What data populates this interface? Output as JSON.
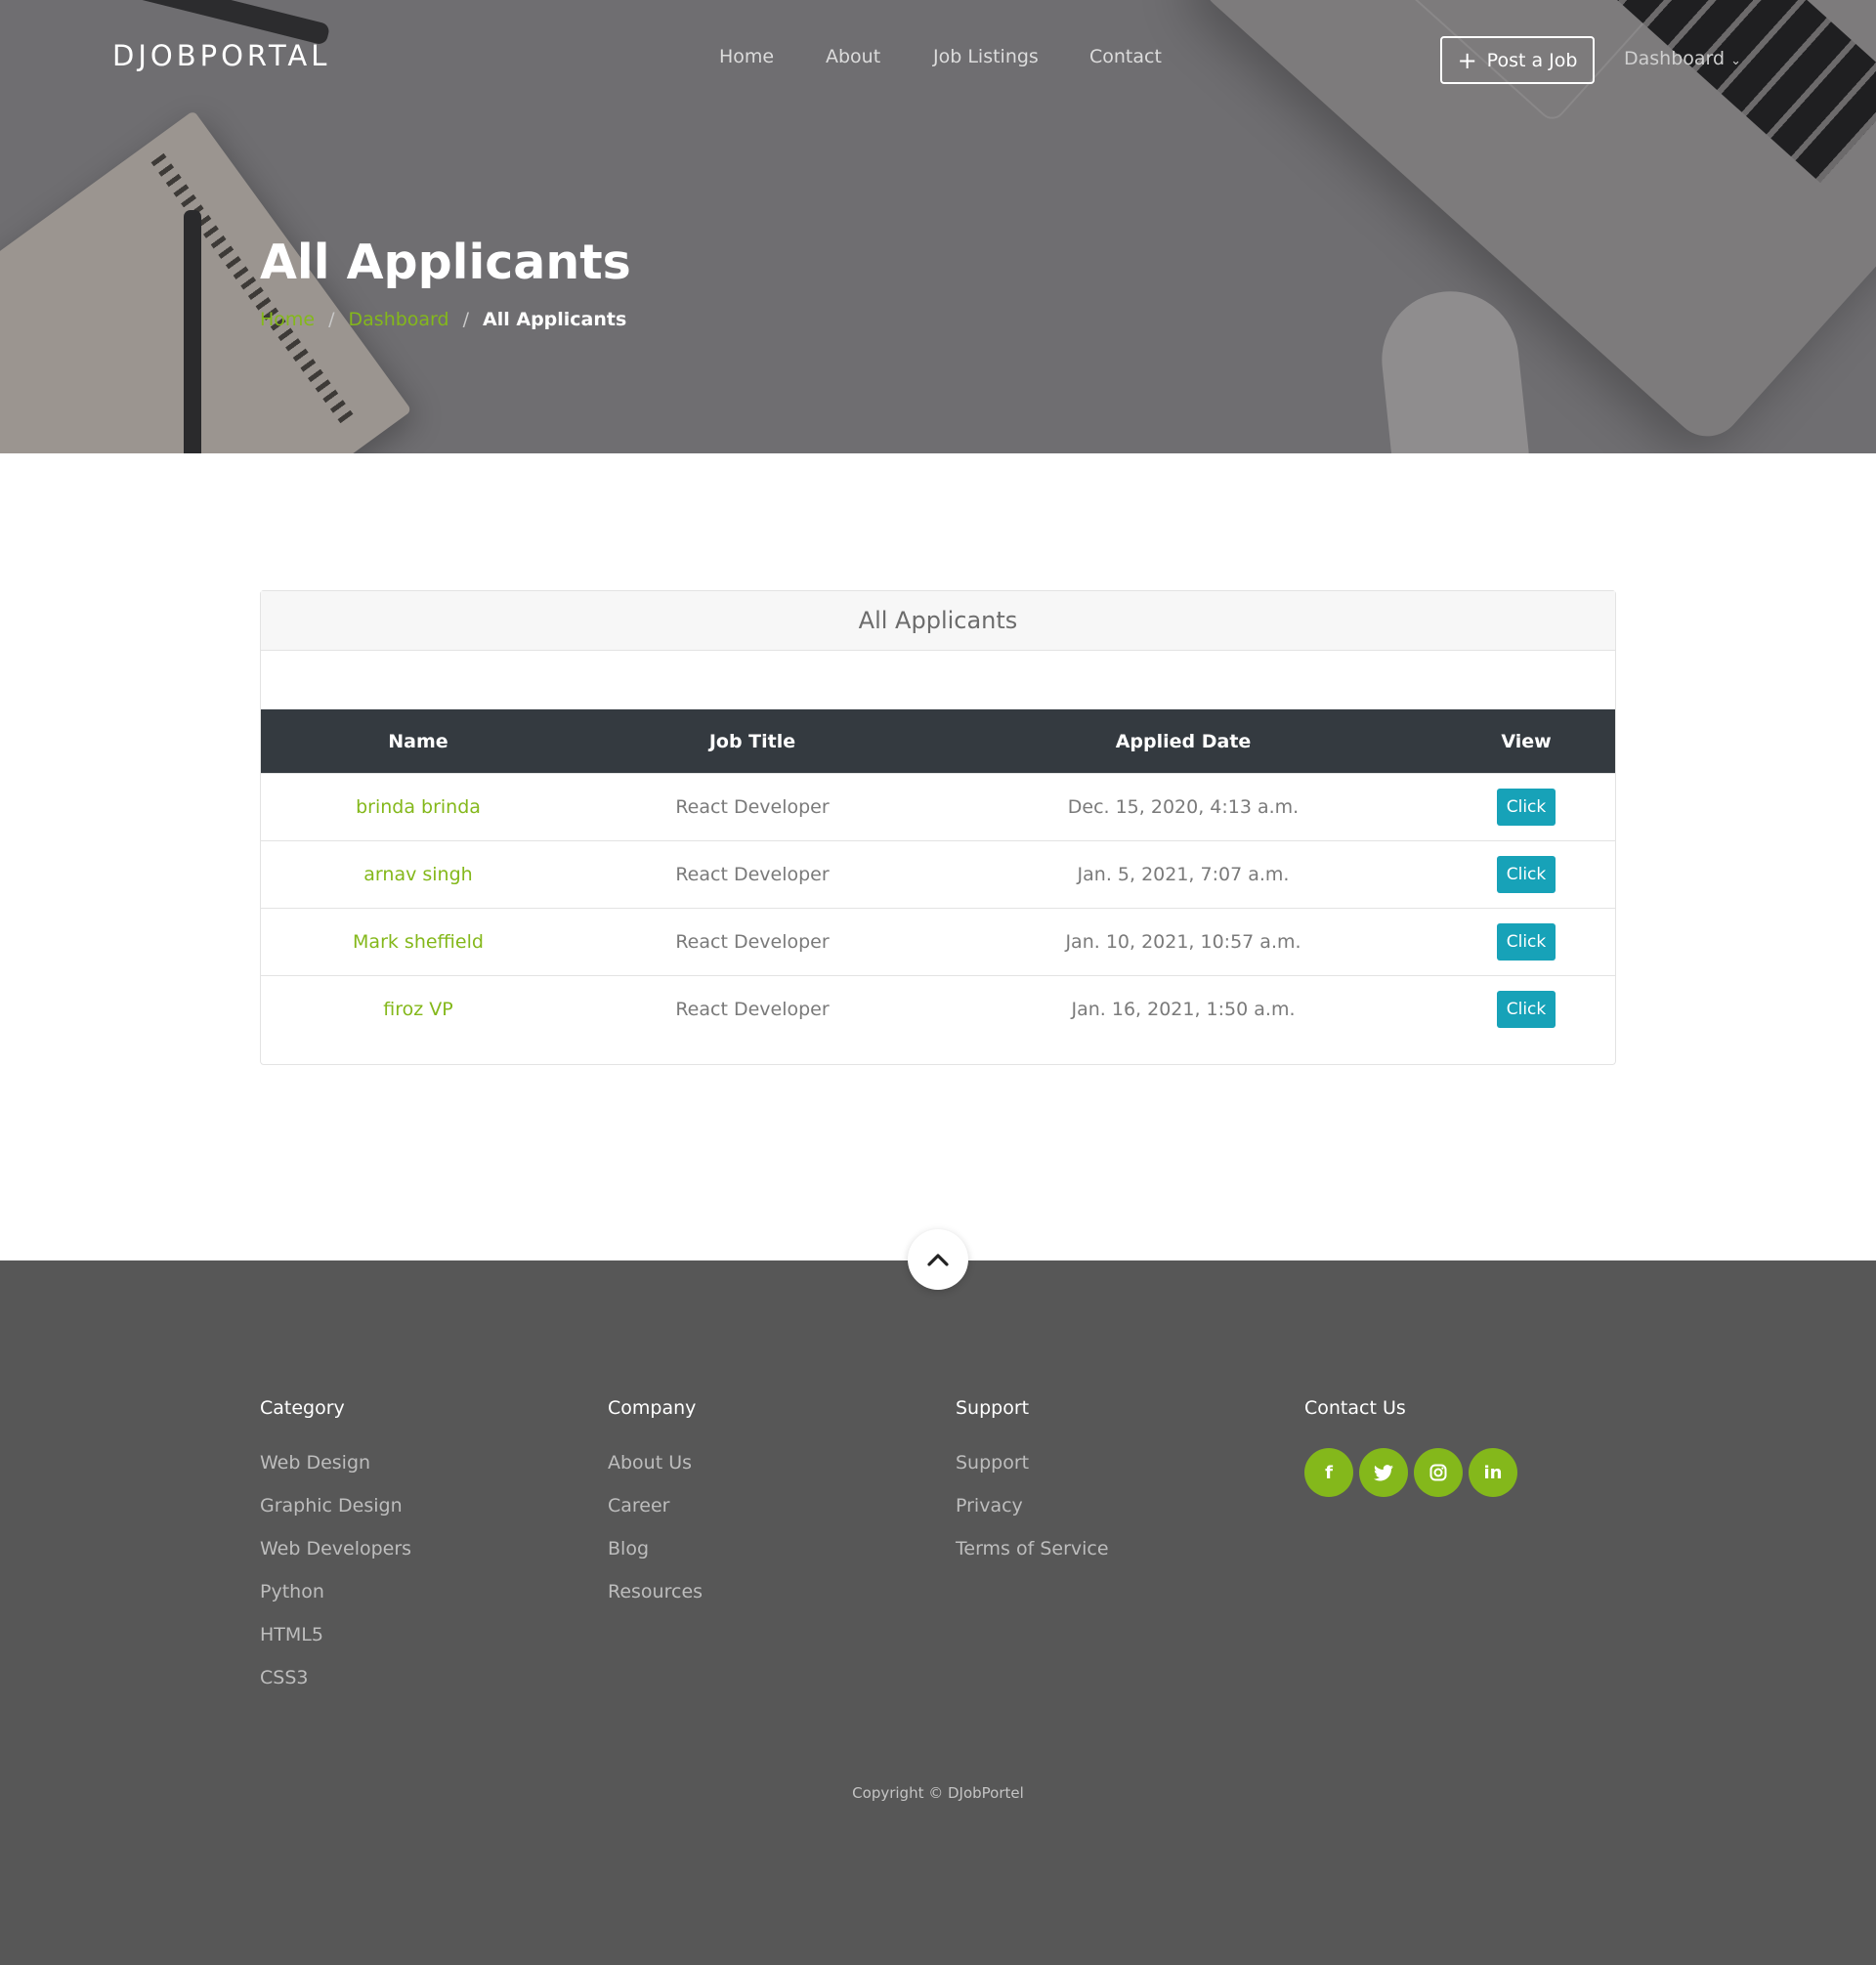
{
  "brand": "DJOBPORTAL",
  "nav": {
    "items": [
      "Home",
      "About",
      "Job Listings",
      "Contact"
    ],
    "post_job": "Post a Job",
    "dashboard": "Dashboard"
  },
  "hero": {
    "title": "All Applicants",
    "breadcrumb": [
      "Home",
      "Dashboard",
      "All Applicants"
    ]
  },
  "card": {
    "header": "All Applicants",
    "columns": [
      "Name",
      "Job Title",
      "Applied Date",
      "View"
    ],
    "rows": [
      {
        "name": "brinda brinda",
        "job": "React Developer",
        "date": "Dec. 15, 2020, 4:13 a.m.",
        "view": "Click"
      },
      {
        "name": "arnav singh",
        "job": "React Developer",
        "date": "Jan. 5, 2021, 7:07 a.m.",
        "view": "Click"
      },
      {
        "name": "Mark sheffield",
        "job": "React Developer",
        "date": "Jan. 10, 2021, 10:57 a.m.",
        "view": "Click"
      },
      {
        "name": "firoz VP",
        "job": "React Developer",
        "date": "Jan. 16, 2021, 1:50 a.m.",
        "view": "Click"
      }
    ]
  },
  "footer": {
    "category": {
      "title": "Category",
      "links": [
        "Web Design",
        "Graphic Design",
        "Web Developers",
        "Python",
        "HTML5",
        "CSS3"
      ]
    },
    "company": {
      "title": "Company",
      "links": [
        "About Us",
        "Career",
        "Blog",
        "Resources"
      ]
    },
    "support": {
      "title": "Support",
      "links": [
        "Support",
        "Privacy",
        "Terms of Service"
      ]
    },
    "contact": {
      "title": "Contact Us",
      "socials": [
        "facebook-icon",
        "twitter-icon",
        "instagram-icon",
        "linkedin-icon"
      ]
    },
    "copyright": "Copyright © DJobPortel"
  },
  "colors": {
    "accent": "#84b81b",
    "button": "#17a2b8",
    "table_head": "#343a40",
    "footer": "#575757"
  }
}
